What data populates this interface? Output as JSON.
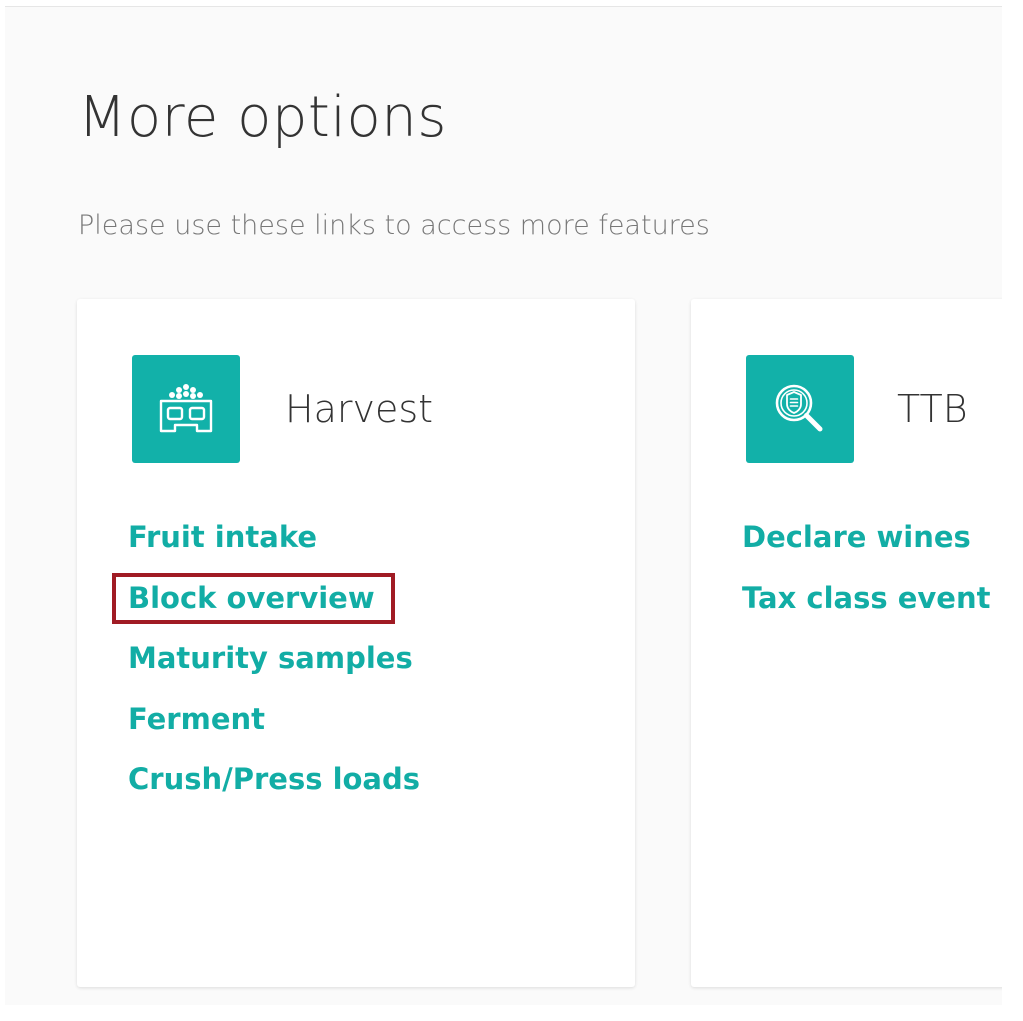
{
  "page": {
    "title": "More options",
    "subtitle": "Please use these links to access more features"
  },
  "cards": {
    "harvest": {
      "title": "Harvest",
      "icon": "harvest-bin-icon",
      "links": [
        "Fruit intake",
        "Block overview",
        "Maturity samples",
        "Ferment",
        "Crush/Press loads"
      ]
    },
    "ttb": {
      "title": "TTB",
      "icon": "search-document-icon",
      "links": [
        "Declare wines",
        "Tax class event h"
      ]
    }
  },
  "colors": {
    "accent": "#12b1a9",
    "link": "#12ada5",
    "highlight_box": "#a01b24"
  }
}
